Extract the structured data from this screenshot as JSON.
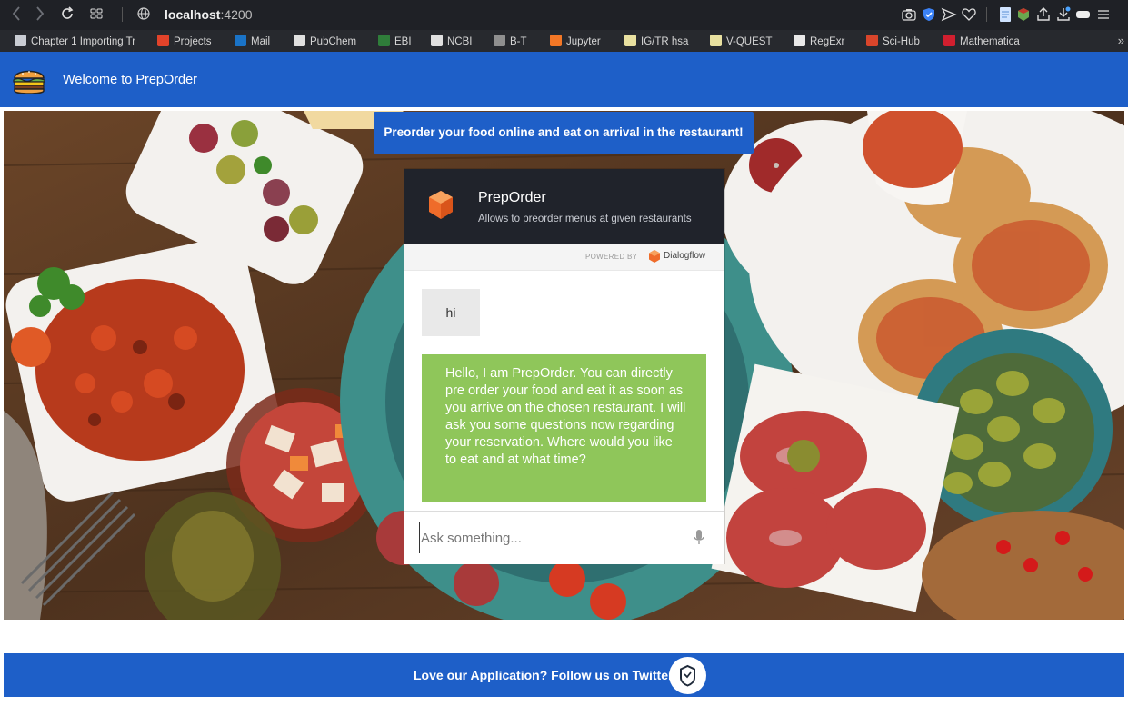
{
  "browser": {
    "url_host": "localhost",
    "url_port": ":4200",
    "bookmarks": [
      {
        "label": "Chapter 1 Importing Tr",
        "color": "#c9ccd3"
      },
      {
        "label": "Projects",
        "color": "#e2432a"
      },
      {
        "label": "Mail",
        "color": "#1a73c7"
      },
      {
        "label": "PubChem",
        "color": "#e0e0e0"
      },
      {
        "label": "EBI",
        "color": "#2f7d3a"
      },
      {
        "label": "NCBI",
        "color": "#e0e0e0"
      },
      {
        "label": "B-T",
        "color": "#8f8f8f"
      },
      {
        "label": "Jupyter",
        "color": "#f37726"
      },
      {
        "label": "IG/TR hsa",
        "color": "#e8e0a0"
      },
      {
        "label": "V-QUEST",
        "color": "#e8e0a0"
      },
      {
        "label": "RegExr",
        "color": "#e8e8e8"
      },
      {
        "label": "Sci-Hub",
        "color": "#d9452b"
      },
      {
        "label": "Mathematica",
        "color": "#d11f2f"
      }
    ],
    "bookmarks_more": "»"
  },
  "header": {
    "title": "Welcome to PrepOrder"
  },
  "banner": {
    "text": "Preorder your food online and eat on arrival in the restaurant!"
  },
  "chat": {
    "agent_name": "PrepOrder",
    "agent_description": "Allows to preorder menus at given restaurants",
    "powered_by": "POWERED BY",
    "powered_brand": "Dialogflow",
    "user_message": "hi",
    "bot_message": "Hello, I am PrepOrder. You can directly pre order your food and eat it as soon as you arrive on the chosen restaurant. I will ask you some questions now regarding your reservation. Where would you like to eat and at what time?",
    "input_placeholder": "Ask something...",
    "input_value": ""
  },
  "footer": {
    "text": "Love our Application? Follow us on Twitter!"
  },
  "colors": {
    "brand_blue": "#1e5fc8",
    "chat_header": "#20232b",
    "bot_bubble": "#8fc65a",
    "user_bubble": "#e9e9e9",
    "dialogflow_orange": "#ef6c2a"
  }
}
